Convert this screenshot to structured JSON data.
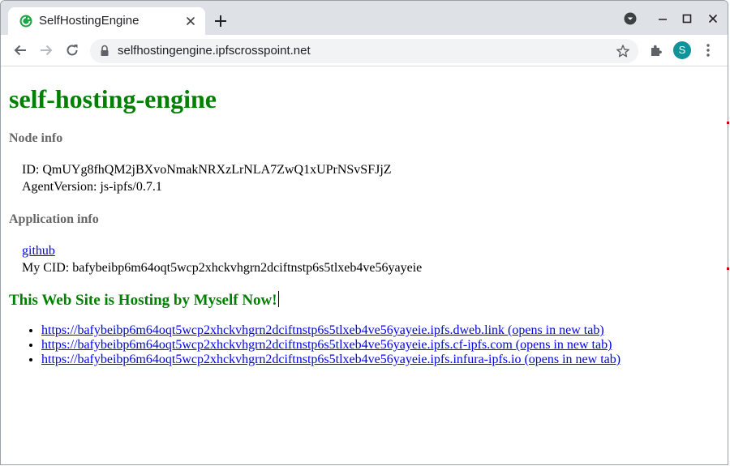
{
  "browser": {
    "tab_title": "SelfHostingEngine",
    "url": "selfhostingengine.ipfscrosspoint.net",
    "profile_initial": "S",
    "favicon_color": "#1ea446",
    "avatar_color": "#12929b"
  },
  "page": {
    "title": "self-hosting-engine",
    "node_info": {
      "heading": "Node info",
      "id_line": "ID: QmUYg8fhQM2jBXvoNmakNRXzLrNLA7ZwQ1xUPrNSvSFJjZ",
      "agent_line": "AgentVersion: js-ipfs/0.7.1"
    },
    "app_info": {
      "heading": "Application info",
      "github_link": "github",
      "cid_line": "My CID: bafybeibp6m64oqt5wcp2xhckvhgrn2dciftnstp6s5tlxeb4ve56yayeie"
    },
    "hosting_heading": "This Web Site is Hosting by Myself Now!",
    "links": [
      "https://bafybeibp6m64oqt5wcp2xhckvhgrn2dciftnstp6s5tlxeb4ve56yayeie.ipfs.dweb.link (opens in new tab)",
      "https://bafybeibp6m64oqt5wcp2xhckvhgrn2dciftnstp6s5tlxeb4ve56yayeie.ipfs.cf-ipfs.com (opens in new tab)",
      "https://bafybeibp6m64oqt5wcp2xhckvhgrn2dciftnstp6s5tlxeb4ve56yayeie.ipfs.infura-ipfs.io (opens in new tab)"
    ],
    "title_color": "#008000",
    "heading_color": "#666666",
    "link_color": "#0000ee"
  },
  "icons": {
    "back": "arrow-left-icon",
    "forward": "arrow-right-icon",
    "reload": "reload-icon",
    "lock": "lock-icon",
    "bookmark": "star-icon",
    "extensions": "puzzle-icon",
    "menu": "kebab-menu-icon"
  }
}
